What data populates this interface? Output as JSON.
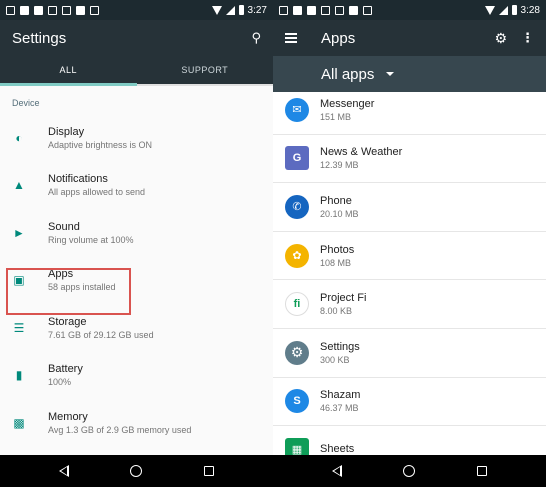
{
  "left": {
    "status_time": "3:27",
    "title": "Settings",
    "tabs": [
      "ALL",
      "SUPPORT"
    ],
    "section": "Device",
    "items": [
      {
        "title": "Display",
        "subtitle": "Adaptive brightness is ON",
        "icon": "brightness-icon"
      },
      {
        "title": "Notifications",
        "subtitle": "All apps allowed to send",
        "icon": "bell-icon"
      },
      {
        "title": "Sound",
        "subtitle": "Ring volume at 100%",
        "icon": "volume-icon"
      },
      {
        "title": "Apps",
        "subtitle": "58 apps installed",
        "icon": "android-icon"
      },
      {
        "title": "Storage",
        "subtitle": "7.61 GB of 29.12 GB used",
        "icon": "storage-icon"
      },
      {
        "title": "Battery",
        "subtitle": "100%",
        "icon": "battery-icon"
      },
      {
        "title": "Memory",
        "subtitle": "Avg 1.3 GB of 2.9 GB memory used",
        "icon": "memory-icon"
      }
    ]
  },
  "right": {
    "status_time": "3:28",
    "title": "Apps",
    "filter": "All apps",
    "apps": [
      {
        "name": "Messenger",
        "size": "151 MB",
        "color": "#1e88e5",
        "glyph": "✉"
      },
      {
        "name": "News & Weather",
        "size": "12.39 MB",
        "color": "#5c6bc0",
        "glyph": "G"
      },
      {
        "name": "Phone",
        "size": "20.10 MB",
        "color": "#1565c0",
        "glyph": "✆"
      },
      {
        "name": "Photos",
        "size": "108 MB",
        "color": "#f4b400",
        "glyph": "✿"
      },
      {
        "name": "Project Fi",
        "size": "8.00 KB",
        "color": "#e0e0e0",
        "glyph": "fi"
      },
      {
        "name": "Settings",
        "size": "300 KB",
        "color": "#607d8b",
        "glyph": "⚙"
      },
      {
        "name": "Shazam",
        "size": "46.37 MB",
        "color": "#1e88e5",
        "glyph": "S"
      },
      {
        "name": "Sheets",
        "size": "",
        "color": "#0f9d58",
        "glyph": "▦"
      }
    ]
  }
}
